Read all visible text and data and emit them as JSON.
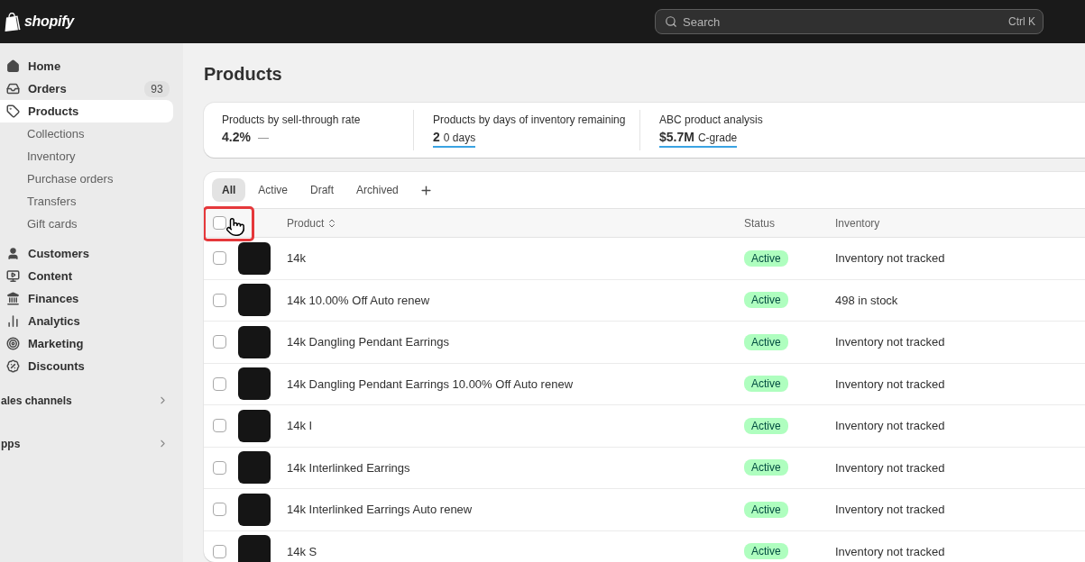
{
  "topbar": {
    "logo": "shopify",
    "search": {
      "placeholder": "Search",
      "shortcut": "Ctrl K"
    }
  },
  "sidebar": {
    "items": [
      {
        "label": "Home",
        "selected": false
      },
      {
        "label": "Orders",
        "badge": "93",
        "selected": false
      },
      {
        "label": "Products",
        "selected": true,
        "children": [
          {
            "label": "Collections",
            "selected": false
          },
          {
            "label": "Inventory",
            "selected": false
          },
          {
            "label": "Purchase orders",
            "selected": false
          },
          {
            "label": "Transfers",
            "selected": false
          },
          {
            "label": "Gift cards",
            "selected": false
          }
        ]
      },
      {
        "label": "Customers",
        "selected": false
      },
      {
        "label": "Content",
        "selected": false
      },
      {
        "label": "Finances",
        "selected": false
      },
      {
        "label": "Analytics",
        "selected": false
      },
      {
        "label": "Marketing",
        "selected": false
      },
      {
        "label": "Discounts",
        "selected": false
      }
    ],
    "sections": [
      {
        "label": "ales channels"
      },
      {
        "label": "pps"
      }
    ]
  },
  "page": {
    "title": "Products"
  },
  "metrics": [
    {
      "label": "Products by sell-through rate",
      "value": "4.2%",
      "detail": "—",
      "underlined": false
    },
    {
      "label": "Products by days of inventory remaining",
      "value": "2",
      "detail": "0 days",
      "underlined": true
    },
    {
      "label": "ABC product analysis",
      "value": "$5.7M",
      "detail": "C-grade",
      "underlined": true
    }
  ],
  "tabs": [
    {
      "label": "All",
      "selected": true
    },
    {
      "label": "Active",
      "selected": false
    },
    {
      "label": "Draft",
      "selected": false
    },
    {
      "label": "Archived",
      "selected": false
    }
  ],
  "table": {
    "select_all": {
      "checked": false,
      "highlighted": true
    },
    "columns": [
      {
        "label": "Product",
        "sortable": true
      },
      {
        "label": "Status",
        "sortable": false
      },
      {
        "label": "Inventory",
        "sortable": false
      }
    ],
    "rows": [
      {
        "checked": false,
        "product": "14k",
        "status": "Active",
        "inventory": "Inventory not tracked"
      },
      {
        "checked": false,
        "product": "14k 10.00% Off Auto renew",
        "status": "Active",
        "inventory": "498 in stock"
      },
      {
        "checked": false,
        "product": "14k Dangling Pendant Earrings",
        "status": "Active",
        "inventory": "Inventory not tracked"
      },
      {
        "checked": false,
        "product": "14k Dangling Pendant Earrings 10.00% Off Auto renew",
        "status": "Active",
        "inventory": "Inventory not tracked"
      },
      {
        "checked": false,
        "product": "14k I",
        "status": "Active",
        "inventory": "Inventory not tracked"
      },
      {
        "checked": false,
        "product": "14k Interlinked Earrings",
        "status": "Active",
        "inventory": "Inventory not tracked"
      },
      {
        "checked": false,
        "product": "14k Interlinked Earrings Auto renew",
        "status": "Active",
        "inventory": "Inventory not tracked"
      },
      {
        "checked": false,
        "product": "14k S",
        "status": "Active",
        "inventory": "Inventory not tracked"
      }
    ]
  }
}
